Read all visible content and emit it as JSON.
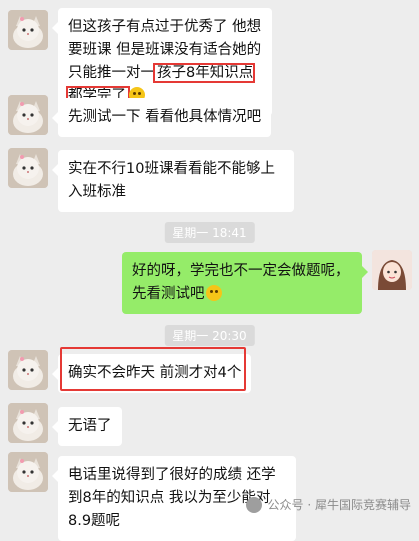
{
  "messages": [
    {
      "side": "left",
      "text": "但这孩子有点过于优秀了 他想要班课 但是班课没有适合她的 只能推一对一",
      "highlight": "孩子8年知识点都学完了"
    },
    {
      "side": "left",
      "text": "先测试一下 看看他具体情况吧"
    },
    {
      "side": "left",
      "text": "实在不行10班课看看能不能够上入班标准"
    },
    {
      "side": "right",
      "text": "好的呀，学完也不一定会做题呢，先看测试吧"
    },
    {
      "side": "left",
      "text": "确实不会昨天 前测才对4个"
    },
    {
      "side": "left",
      "text": "无语了"
    },
    {
      "side": "left",
      "text": "电话里说得到了很好的成绩 还学到8年的知识点 我以为至少能对8.9题呢"
    }
  ],
  "timestamps": [
    "星期一 18:41",
    "星期一 20:30"
  ],
  "watermark": "公众号 · 犀牛国际竞赛辅导",
  "colors": {
    "bg": "#ededed",
    "left_bubble": "#ffffff",
    "right_bubble": "#95ec69",
    "highlight": "#e53935"
  }
}
